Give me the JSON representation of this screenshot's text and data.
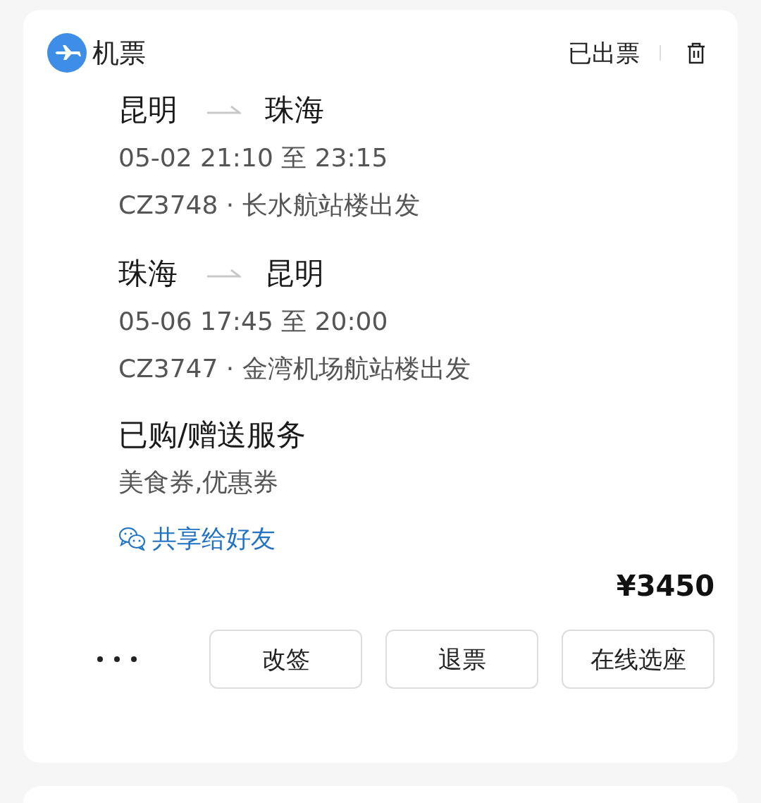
{
  "header": {
    "title": "机票",
    "status": "已出票"
  },
  "flights": [
    {
      "from": "昆明",
      "to": "珠海",
      "time": "05-02 21:10 至 23:15",
      "detail": "CZ3748 · 长水航站楼出发"
    },
    {
      "from": "珠海",
      "to": "昆明",
      "time": "05-06 17:45 至 20:00",
      "detail": "CZ3747 · 金湾机场航站楼出发"
    }
  ],
  "services": {
    "title": "已购/赠送服务",
    "items": "美食券,优惠券"
  },
  "share": {
    "label": "共享给好友"
  },
  "price": "¥3450",
  "buttons": [
    "改签",
    "退票",
    "在线选座"
  ]
}
